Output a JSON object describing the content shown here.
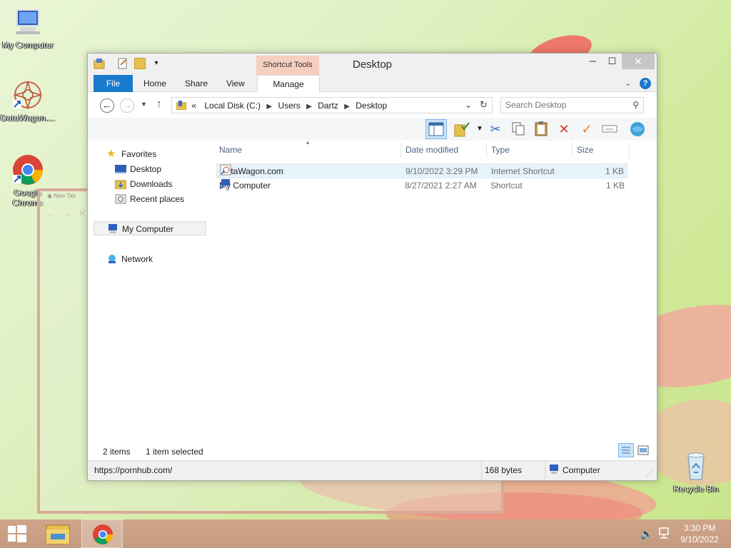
{
  "desktop": {
    "icons": [
      {
        "label": "My Computer"
      },
      {
        "label": "DataWagon...."
      },
      {
        "label": "Google Chrome"
      },
      {
        "label": "Recycle Bin"
      }
    ],
    "ghost_tab": "New Tab"
  },
  "explorer": {
    "title": "Desktop",
    "context_group": "Shortcut Tools",
    "tabs": [
      {
        "label": "File"
      },
      {
        "label": "Home"
      },
      {
        "label": "Share"
      },
      {
        "label": "View"
      },
      {
        "label": "Manage"
      }
    ],
    "address": {
      "overflow": "«",
      "crumbs": [
        "Local Disk (C:)",
        "Users",
        "Dartz",
        "Desktop"
      ]
    },
    "search": {
      "placeholder": "Search Desktop"
    },
    "nav": {
      "favorites": "Favorites",
      "desktop": "Desktop",
      "downloads": "Downloads",
      "recent": "Recent places",
      "computer": "My Computer",
      "network": "Network"
    },
    "columns": {
      "name": "Name",
      "date": "Date modified",
      "type": "Type",
      "size": "Size"
    },
    "files": [
      {
        "name": "DataWagon.com",
        "date": "9/10/2022 3:29 PM",
        "type": "Internet Shortcut",
        "size": "1 KB"
      },
      {
        "name": "My Computer",
        "date": "8/27/2021 2:27 AM",
        "type": "Shortcut",
        "size": "1 KB"
      }
    ],
    "status": {
      "count": "2 items",
      "selected": "1 item selected"
    },
    "bottom": {
      "url": "https://pornhub.com/",
      "bytes": "168 bytes",
      "location": "Computer"
    }
  },
  "taskbar": {
    "time": "3:30 PM",
    "date": "9/10/2022"
  },
  "colors": {
    "accent": "#1979ca",
    "taskbar": "#c59b80",
    "context": "#f7cfc1"
  }
}
